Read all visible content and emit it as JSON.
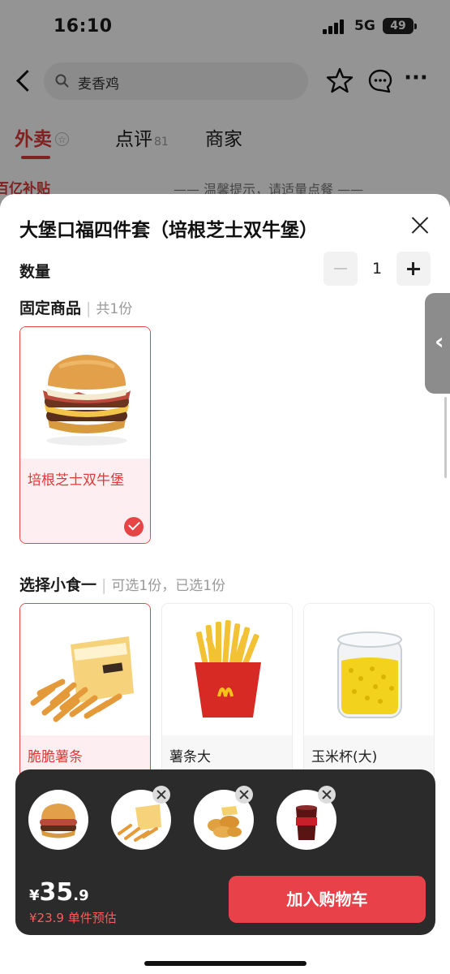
{
  "status_bar": {
    "time": "16:10",
    "network": "5G",
    "battery": "49"
  },
  "top_nav": {
    "search_text": "麦香鸡"
  },
  "tabs": [
    {
      "label": "外卖",
      "badge": "☆"
    },
    {
      "label": "点评",
      "count": "81"
    },
    {
      "label": "商家"
    }
  ],
  "background": {
    "subsidy": "百亿补贴",
    "notice": "—— 温馨提示，请适量点餐 ——"
  },
  "sheet": {
    "title": "大堡口福四件套（培根芝士双牛堡）",
    "quantity_label": "数量",
    "quantity_value": "1",
    "fixed_section": {
      "title": "固定商品",
      "separator": "|",
      "subtitle": "共1份"
    },
    "fixed_items": [
      {
        "name": "培根芝士双牛堡",
        "icon": "burger-image",
        "selected": true
      }
    ],
    "snack_section": {
      "title": "选择小食一",
      "separator": "|",
      "subtitle": "可选1份，已选1份"
    },
    "snack_items": [
      {
        "name": "脆脆薯条",
        "icon": "crinkle-fries-image",
        "selected": true
      },
      {
        "name": "薯条大",
        "icon": "fries-image",
        "selected": false
      },
      {
        "name": "玉米杯(大)",
        "icon": "corn-cup-image",
        "selected": false
      }
    ]
  },
  "cart_bar": {
    "thumbnails": [
      "burger-thumb",
      "crinkle-fries-thumb",
      "nuggets-thumb",
      "cola-thumb"
    ],
    "price_currency": "¥",
    "price_integer": "35",
    "price_decimal": ".9",
    "price_estimate": "¥23.9 单件预估",
    "add_to_cart": "加入购物车"
  },
  "colors": {
    "accent": "#e84149",
    "selected_bg": "#fdeff1",
    "bar_bg": "#2b2b2b"
  }
}
